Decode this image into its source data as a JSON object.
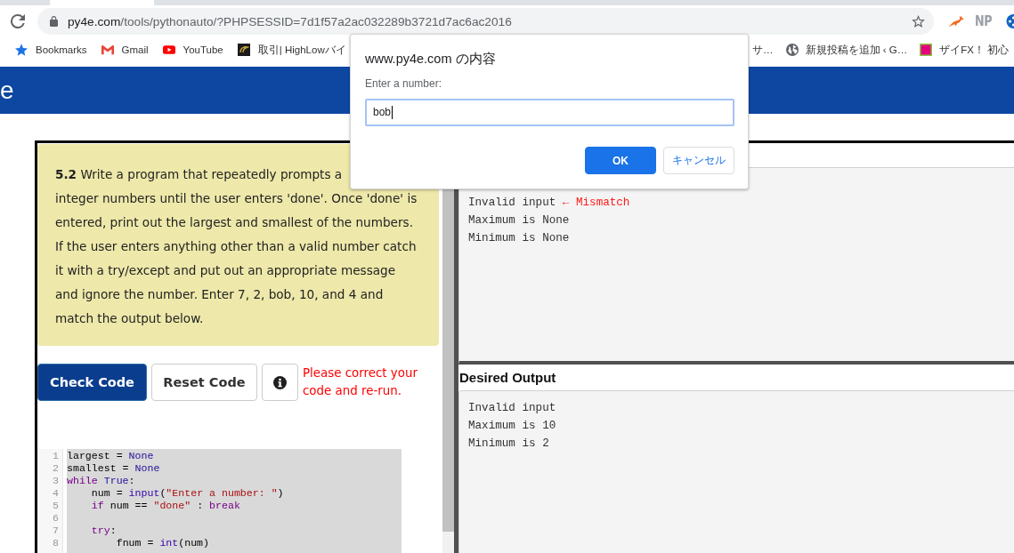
{
  "browser": {
    "tabs": [
      {
        "selected": true
      }
    ],
    "address": {
      "host": "py4e.com",
      "path": "/tools/pythonauto/?PHPSESSID=7d1f57a2ac032289b3721d7ac6ac2016"
    },
    "extension_label": "NP",
    "bookmarks_left": [
      {
        "label": "Bookmarks"
      },
      {
        "label": "Gmail"
      },
      {
        "label": "YouTube"
      },
      {
        "label": "取引| HighLowバイ"
      }
    ],
    "bookmarks_right": [
      {
        "label": "サ…"
      },
      {
        "label": "新規投稿を追加 ‹ G…"
      },
      {
        "label": "ザイFX！ 初心"
      }
    ]
  },
  "site_header": {
    "title": "e"
  },
  "instructions": {
    "lead": "**5.2** Write a program that repeatedly prompts a",
    "text": "integer numbers until the user enters 'done'. Once 'done' is entered, print out the largest and smallest of the numbers. If the user enters anything other than a valid number catch it with a try/except and put out an appropriate message and ignore the number. Enter 7, 2, bob, 10, and 4 and match the output below."
  },
  "buttons": [
    {
      "kind": "primary",
      "label": "Check Code"
    },
    {
      "kind": "default",
      "label": "Reset Code"
    },
    {
      "kind": "info"
    }
  ],
  "message": "Please correct your code and re-run.",
  "editor": {
    "lines": [
      {
        "number": "1",
        "tokens": [
          {
            "kind": "plain",
            "text": "largest = "
          },
          {
            "kind": "atom",
            "text": "None"
          }
        ]
      },
      {
        "number": "2",
        "tokens": [
          {
            "kind": "plain",
            "text": "smallest = "
          },
          {
            "kind": "atom",
            "text": "None"
          }
        ]
      },
      {
        "number": "3",
        "tokens": [
          {
            "kind": "keyword",
            "text": "while "
          },
          {
            "kind": "atom",
            "text": "True"
          },
          {
            "kind": "plain",
            "text": ":"
          }
        ]
      },
      {
        "number": "4",
        "tokens": [
          {
            "kind": "plain",
            "text": "    num = "
          },
          {
            "kind": "builtin",
            "text": "input"
          },
          {
            "kind": "plain",
            "text": "("
          },
          {
            "kind": "string",
            "text": "\"Enter a number: \""
          },
          {
            "kind": "plain",
            "text": ")"
          }
        ]
      },
      {
        "number": "5",
        "tokens": [
          {
            "kind": "keyword",
            "text": "    if"
          },
          {
            "kind": "plain",
            "text": " num == "
          },
          {
            "kind": "string",
            "text": "\"done\""
          },
          {
            "kind": "plain",
            "text": " : "
          },
          {
            "kind": "keyword",
            "text": "break"
          }
        ]
      },
      {
        "number": "6"
      },
      {
        "number": "7",
        "tokens": [
          {
            "kind": "keyword",
            "text": "    try"
          },
          {
            "kind": "plain",
            "text": ":"
          }
        ]
      },
      {
        "number": "8",
        "tokens": [
          {
            "kind": "plain",
            "text": "        fnum = "
          },
          {
            "kind": "builtin",
            "text": "int"
          },
          {
            "kind": "plain",
            "text": "(num)"
          }
        ]
      }
    ]
  },
  "your_output": {
    "lines": [
      {
        "text": "Invalid input",
        "note": "← Mismatch"
      },
      {
        "text": "Maximum is None"
      },
      {
        "text": "Minimum is None"
      }
    ]
  },
  "desired_output": {
    "title": "Desired Output",
    "lines": [
      "Invalid input",
      "Maximum is 10",
      "Minimum is 2"
    ]
  },
  "dialog": {
    "title": "www.py4e.com の内容",
    "prompt": "Enter a number:",
    "field": {
      "value": "bob",
      "focused": true
    },
    "buttons": [
      {
        "kind": "primary",
        "label": "OK"
      },
      {
        "kind": "secondary",
        "label": "キャンセル"
      }
    ]
  }
}
